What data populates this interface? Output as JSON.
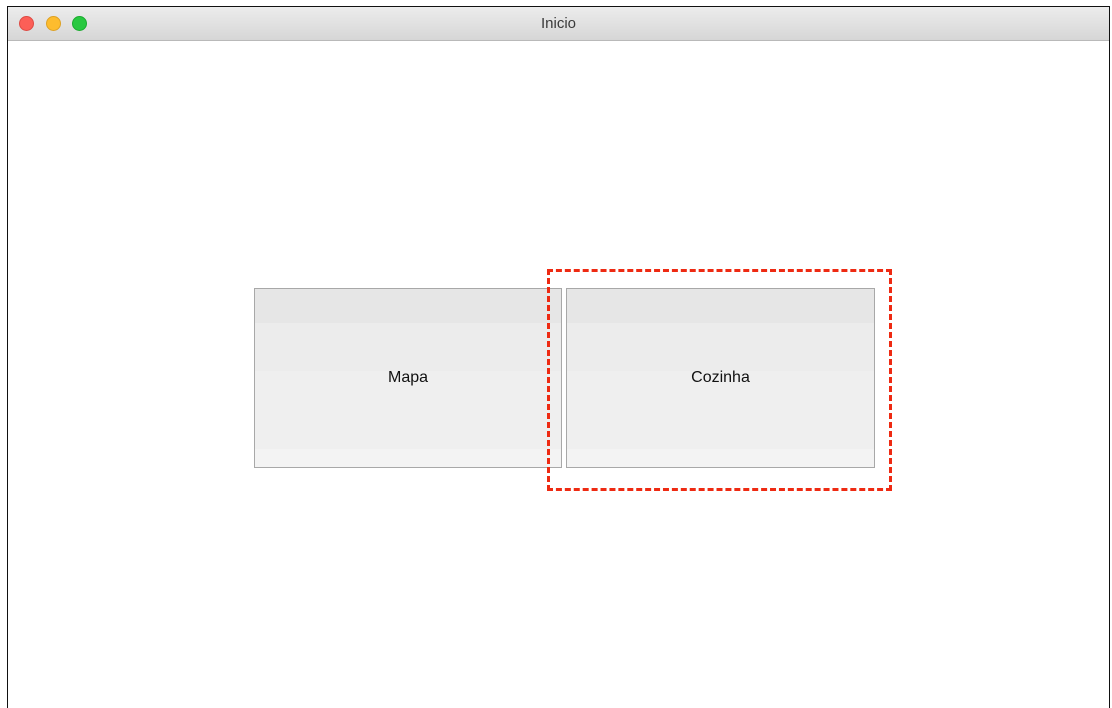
{
  "window": {
    "title": "Inicio",
    "controls": [
      "close",
      "minimize",
      "maximize"
    ]
  },
  "buttons": {
    "mapa_label": "Mapa",
    "cozinha_label": "Cozinha"
  },
  "colors": {
    "highlight": "#ee2a12",
    "close": "#fc5f57",
    "minimize": "#fdbc2e",
    "maximize": "#28c840"
  }
}
